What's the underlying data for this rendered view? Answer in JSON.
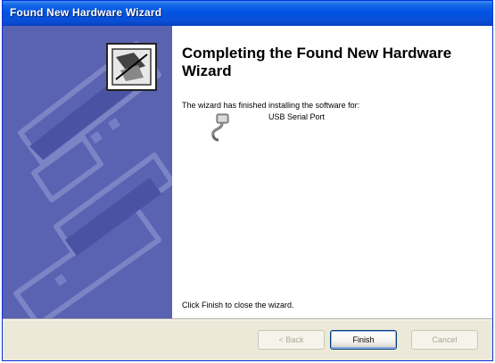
{
  "window": {
    "title": "Found New Hardware Wizard"
  },
  "main": {
    "heading": "Completing the Found New Hardware Wizard",
    "description": "The wizard has finished installing the software for:",
    "device_name": "USB Serial Port",
    "finish_hint": "Click Finish to close the wizard."
  },
  "buttons": {
    "back_label": "< Back",
    "finish_label": "Finish",
    "cancel_label": "Cancel"
  },
  "icons": {
    "wizard": "hardware-wizard-icon",
    "device": "serial-port-icon"
  },
  "colors": {
    "titlebar": "#0054e3",
    "banner": "#5a63b2",
    "window_bg": "#ece9d8"
  }
}
